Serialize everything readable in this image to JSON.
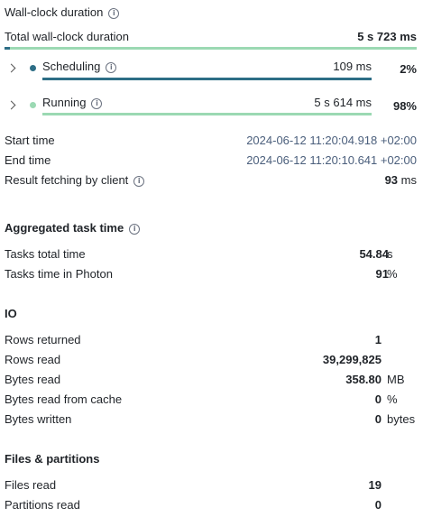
{
  "wall_clock": {
    "title": "Wall-clock duration",
    "total_label": "Total wall-clock duration",
    "total_value": "5 s 723 ms",
    "total_bar_fraction": 1.0,
    "phases": [
      {
        "label": "Scheduling",
        "value": "109 ms",
        "percent": "2%",
        "bar_fraction": 1.0,
        "color": "#2d6e86"
      },
      {
        "label": "Running",
        "value": "5 s 614 ms",
        "percent": "98%",
        "bar_fraction": 1.0,
        "color": "#9bd9b3"
      }
    ],
    "total_bar_color": "#2d6e86",
    "total_bar_fill_color": "#9bd9b3"
  },
  "timing": {
    "start_label": "Start time",
    "start_value": "2024-06-12 11:20:04.918 +02:00",
    "end_label": "End time",
    "end_value": "2024-06-12 11:20:10.641 +02:00",
    "fetch_label": "Result fetching by client",
    "fetch_value": "93",
    "fetch_unit": "ms"
  },
  "aggregated": {
    "title": "Aggregated task time",
    "rows": [
      {
        "label": "Tasks total time",
        "value": "54.84",
        "unit": "s"
      },
      {
        "label": "Tasks time in Photon",
        "value": "91",
        "unit": "%"
      }
    ]
  },
  "io": {
    "title": "IO",
    "rows": [
      {
        "label": "Rows returned",
        "value": "1",
        "unit": ""
      },
      {
        "label": "Rows read",
        "value": "39,299,825",
        "unit": ""
      },
      {
        "label": "Bytes read",
        "value": "358.80",
        "unit": "MB"
      },
      {
        "label": "Bytes read from cache",
        "value": "0",
        "unit": "%"
      },
      {
        "label": "Bytes written",
        "value": "0",
        "unit": "bytes"
      }
    ]
  },
  "files": {
    "title": "Files & partitions",
    "rows": [
      {
        "label": "Files read",
        "value": "19",
        "unit": ""
      },
      {
        "label": "Partitions read",
        "value": "0",
        "unit": ""
      }
    ]
  }
}
